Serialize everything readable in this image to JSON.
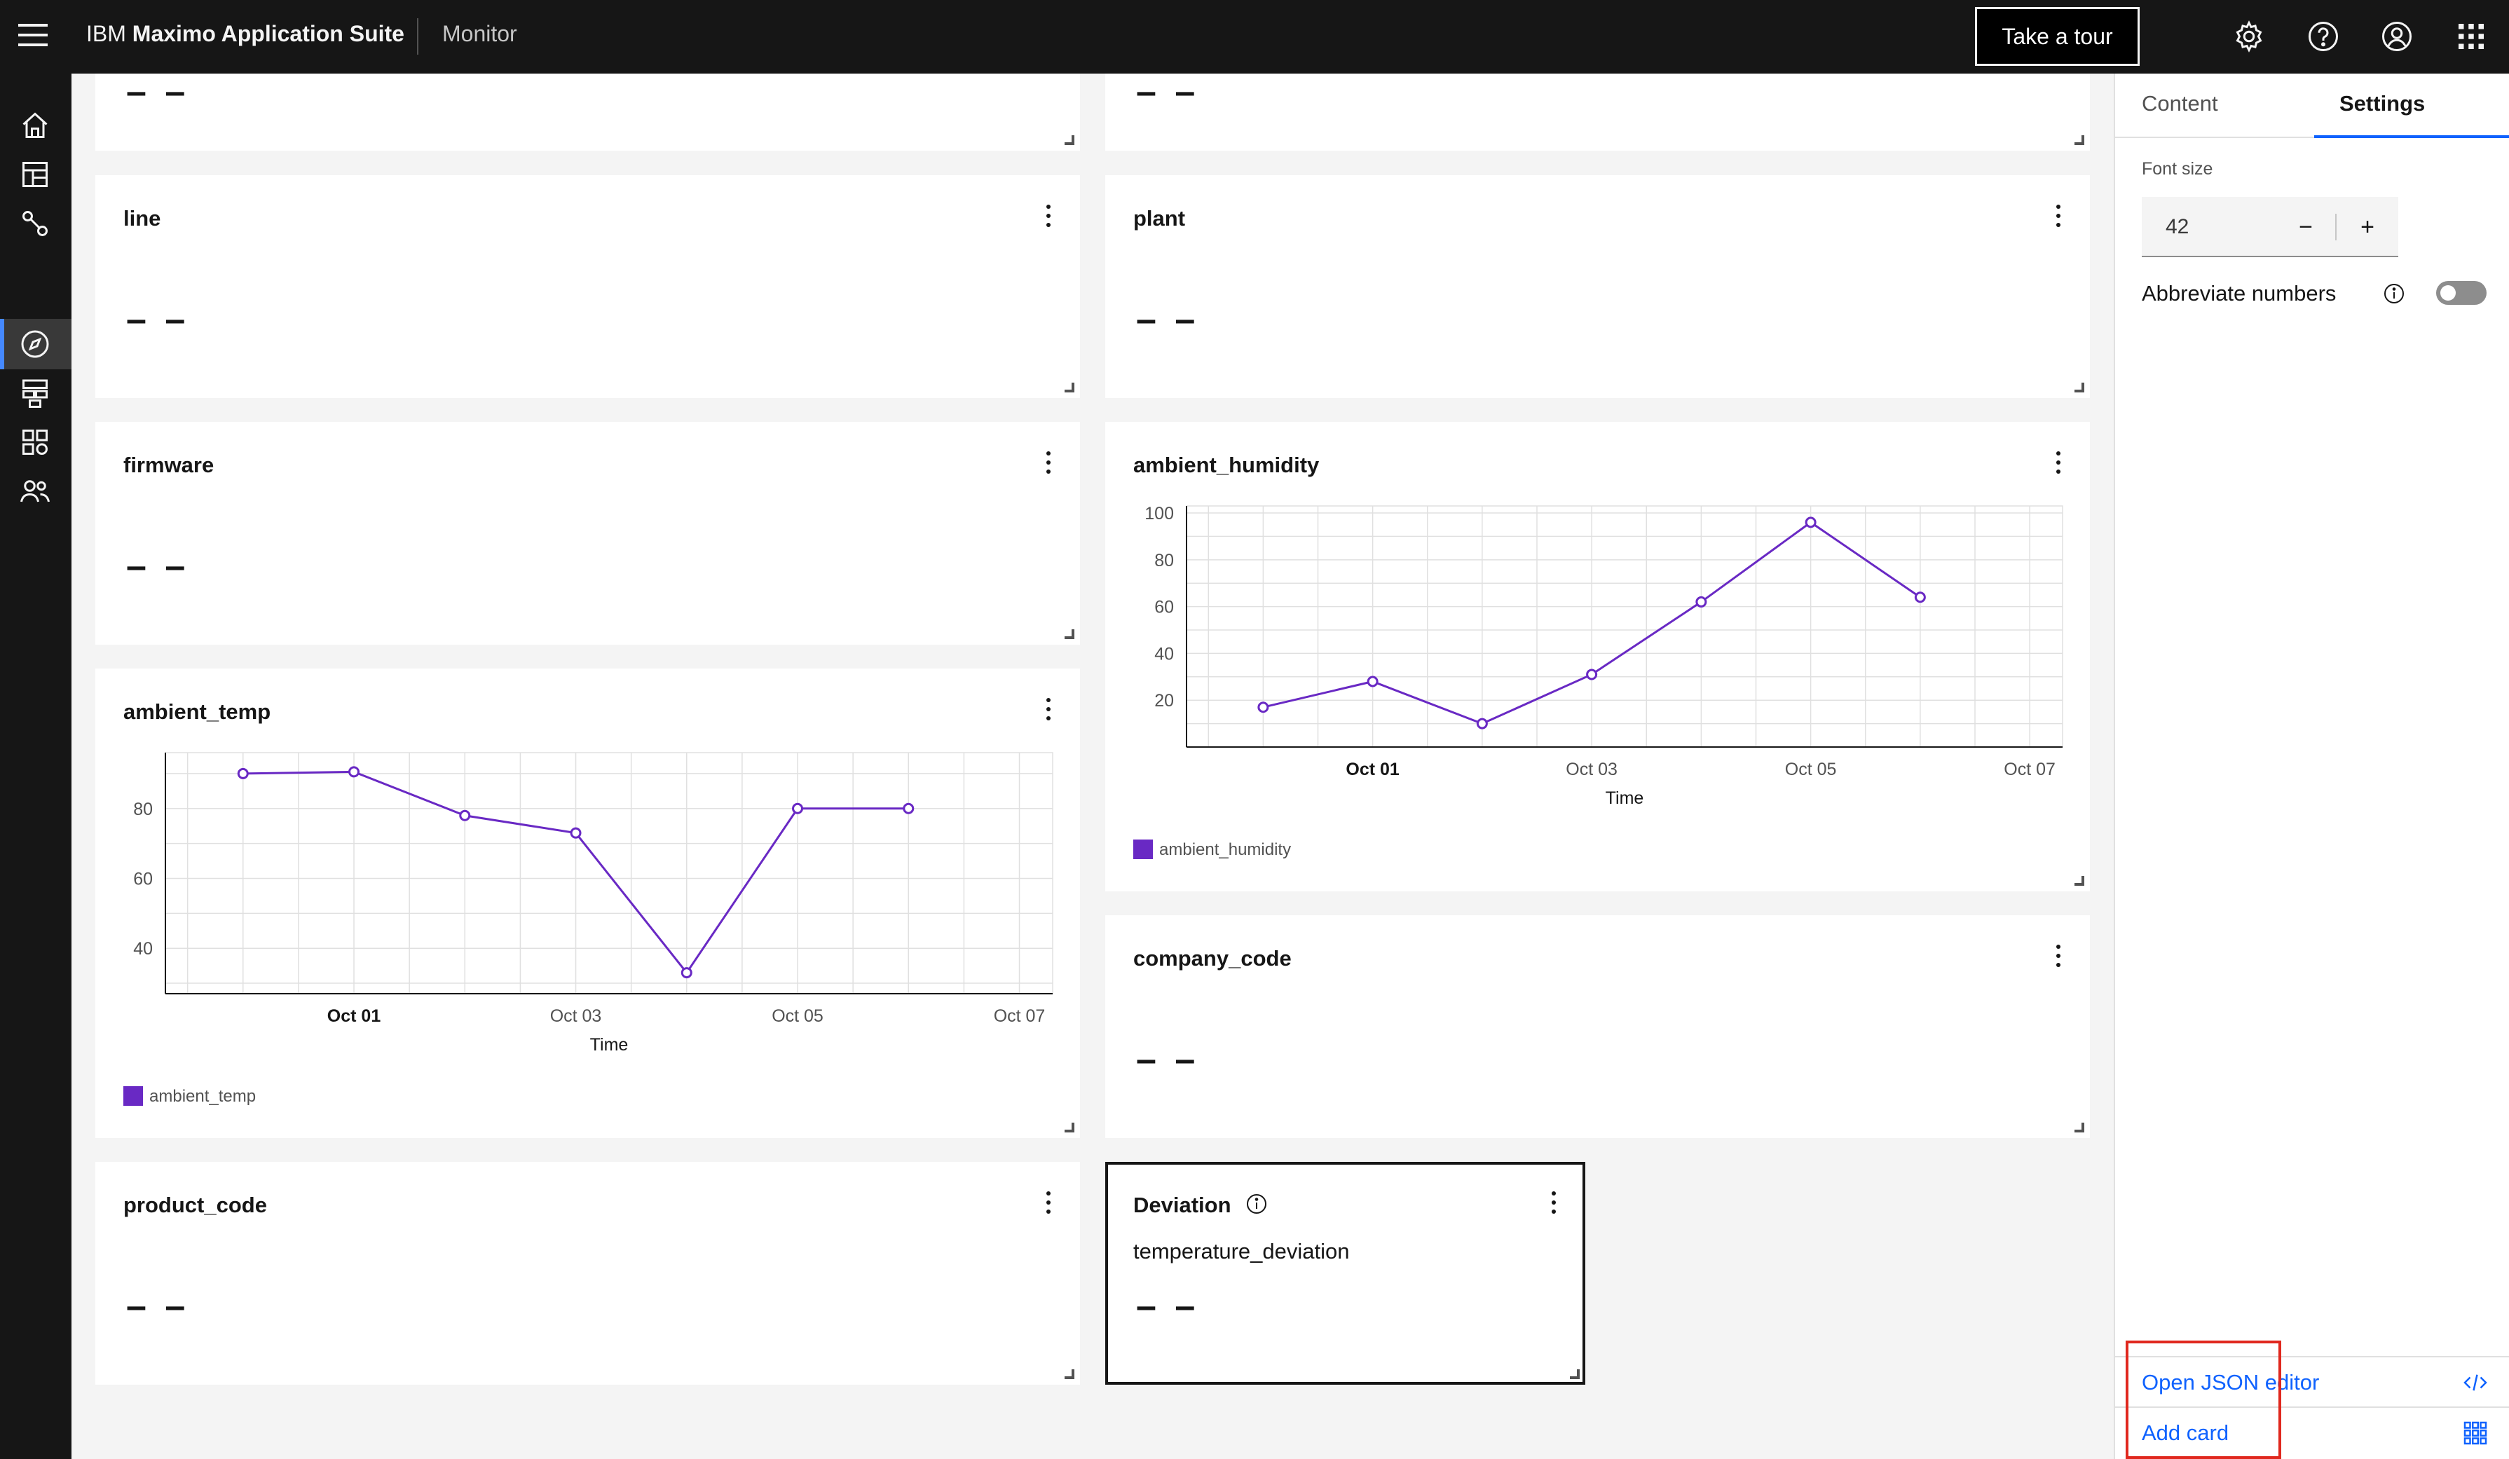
{
  "header": {
    "brand_prefix": "IBM",
    "brand_name": "Maximo Application Suite",
    "app_name": "Monitor",
    "tour_button": "Take a tour"
  },
  "cards": {
    "top_left_value": "– –",
    "top_right_value": "– –",
    "line": {
      "title": "line",
      "value": "– –"
    },
    "plant": {
      "title": "plant",
      "value": "– –"
    },
    "firmware": {
      "title": "firmware",
      "value": "– –"
    },
    "ambient_humidity": {
      "title": "ambient_humidity",
      "legend": "ambient_humidity"
    },
    "ambient_temp": {
      "title": "ambient_temp",
      "legend": "ambient_temp"
    },
    "company_code": {
      "title": "company_code",
      "value": "– –"
    },
    "product_code": {
      "title": "product_code",
      "value": "– –"
    },
    "deviation": {
      "title": "Deviation",
      "subtitle": "temperature_deviation",
      "value": "– –"
    }
  },
  "panel": {
    "tab_content": "Content",
    "tab_settings": "Settings",
    "font_size_label": "Font size",
    "font_size_value": "42",
    "decrement": "−",
    "increment": "+",
    "abbreviate_label": "Abbreviate numbers",
    "abbreviate_on": false,
    "open_json": "Open JSON editor",
    "add_card": "Add card"
  },
  "colors": {
    "series": "#6929c4",
    "link": "#0f62fe",
    "header_bg": "#161616",
    "highlight": "#e0281e"
  },
  "chart_data": [
    {
      "type": "line",
      "title": "ambient_humidity",
      "xlabel": "Time",
      "ylabel": "",
      "x_ticks": [
        "Oct 01",
        "Oct 03",
        "Oct 05",
        "Oct 07"
      ],
      "y_ticks": [
        20,
        40,
        60,
        80,
        100
      ],
      "ylim": [
        0,
        103
      ],
      "series": [
        {
          "name": "ambient_humidity",
          "x": [
            "Sep 30",
            "Oct 01",
            "Oct 02",
            "Oct 03",
            "Oct 04",
            "Oct 05",
            "Oct 06"
          ],
          "values": [
            17,
            28,
            10,
            31,
            62,
            96,
            64
          ]
        }
      ],
      "legend": "bottom-left",
      "grid": true
    },
    {
      "type": "line",
      "title": "ambient_temp",
      "xlabel": "Time",
      "ylabel": "",
      "x_ticks": [
        "Oct 01",
        "Oct 03",
        "Oct 05",
        "Oct 07"
      ],
      "y_ticks": [
        40,
        60,
        80
      ],
      "ylim": [
        27,
        96
      ],
      "series": [
        {
          "name": "ambient_temp",
          "x": [
            "Sep 30",
            "Oct 01",
            "Oct 02",
            "Oct 03",
            "Oct 04",
            "Oct 05",
            "Oct 06"
          ],
          "values": [
            90,
            90.5,
            78,
            73,
            33,
            80,
            80
          ]
        }
      ],
      "legend": "bottom-left",
      "grid": true
    }
  ]
}
